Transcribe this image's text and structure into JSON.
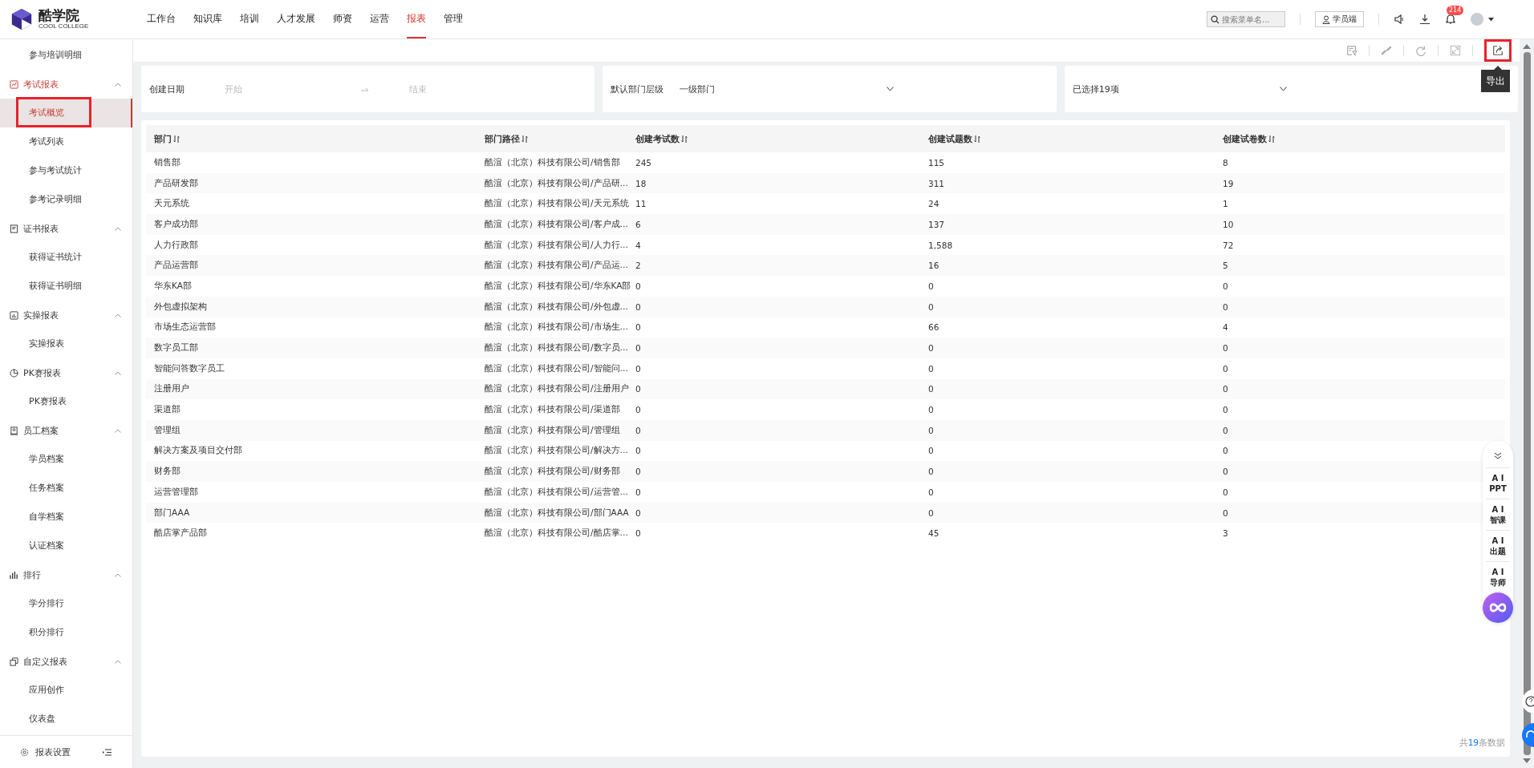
{
  "brand": {
    "name": "酷学院",
    "sub": "COOL COLLEGE"
  },
  "nav": [
    {
      "label": "工作台",
      "selected": false
    },
    {
      "label": "知识库",
      "selected": false
    },
    {
      "label": "培训",
      "selected": false
    },
    {
      "label": "人才发展",
      "selected": false
    },
    {
      "label": "师资",
      "selected": false
    },
    {
      "label": "运营",
      "selected": false
    },
    {
      "label": "报表",
      "selected": true
    },
    {
      "label": "管理",
      "selected": false
    }
  ],
  "header_right": {
    "search": {
      "placeholder": "搜索菜单名..."
    },
    "student_button": "学员端",
    "notification_count": "214"
  },
  "sidebar": {
    "leading_items": [
      {
        "label": "参与培训明细",
        "selected": false,
        "highlighted": false
      }
    ],
    "groups": [
      {
        "label": "考试报表",
        "active": true,
        "expanded": true,
        "children": [
          {
            "label": "考试概览",
            "selected": true,
            "highlighted": true
          },
          {
            "label": "考试列表",
            "selected": false,
            "highlighted": false
          },
          {
            "label": "参与考试统计",
            "selected": false,
            "highlighted": false
          },
          {
            "label": "参考记录明细",
            "selected": false,
            "highlighted": false
          }
        ]
      },
      {
        "label": "证书报表",
        "active": false,
        "expanded": true,
        "children": [
          {
            "label": "获得证书统计",
            "selected": false,
            "highlighted": false
          },
          {
            "label": "获得证书明细",
            "selected": false,
            "highlighted": false
          }
        ]
      },
      {
        "label": "实操报表",
        "active": false,
        "expanded": true,
        "children": [
          {
            "label": "实操报表",
            "selected": false,
            "highlighted": false
          }
        ]
      },
      {
        "label": "PK赛报表",
        "active": false,
        "expanded": true,
        "children": [
          {
            "label": "PK赛报表",
            "selected": false,
            "highlighted": false
          }
        ]
      },
      {
        "label": "员工档案",
        "active": false,
        "expanded": true,
        "children": [
          {
            "label": "学员档案",
            "selected": false,
            "highlighted": false
          },
          {
            "label": "任务档案",
            "selected": false,
            "highlighted": false
          },
          {
            "label": "自学档案",
            "selected": false,
            "highlighted": false
          },
          {
            "label": "认证档案",
            "selected": false,
            "highlighted": false
          }
        ]
      },
      {
        "label": "排行",
        "active": false,
        "expanded": true,
        "children": [
          {
            "label": "学分排行",
            "selected": false,
            "highlighted": false
          },
          {
            "label": "积分排行",
            "selected": false,
            "highlighted": false
          }
        ]
      },
      {
        "label": "自定义报表",
        "active": false,
        "expanded": true,
        "children": [
          {
            "label": "应用创作",
            "selected": false,
            "highlighted": false
          },
          {
            "label": "仪表盘",
            "selected": false,
            "highlighted": false
          }
        ]
      }
    ],
    "footer": "报表设置"
  },
  "toolbar": {
    "export_highlighted": true,
    "tooltip": "导出"
  },
  "filters": {
    "date": {
      "label": "创建日期",
      "start_placeholder": "开始",
      "end_placeholder": "结束"
    },
    "level": {
      "label": "默认部门层级",
      "value": "一级部门"
    },
    "selection": {
      "value": "已选择19项"
    }
  },
  "table": {
    "columns": [
      "部门",
      "部门路径",
      "创建考试数",
      "创建试题数",
      "创建试卷数"
    ],
    "rows": [
      [
        "销售部",
        "酷渲（北京）科技有限公司/销售部",
        "245",
        "115",
        "8"
      ],
      [
        "产品研发部",
        "酷渲（北京）科技有限公司/产品研…",
        "18",
        "311",
        "19"
      ],
      [
        "天元系统",
        "酷渲（北京）科技有限公司/天元系统",
        "11",
        "24",
        "1"
      ],
      [
        "客户成功部",
        "酷渲（北京）科技有限公司/客户成…",
        "6",
        "137",
        "10"
      ],
      [
        "人力行政部",
        "酷渲（北京）科技有限公司/人力行…",
        "4",
        "1,588",
        "72"
      ],
      [
        "产品运营部",
        "酷渲（北京）科技有限公司/产品运…",
        "2",
        "16",
        "5"
      ],
      [
        "华东KA部",
        "酷渲（北京）科技有限公司/华东KA部",
        "0",
        "0",
        "0"
      ],
      [
        "外包虚拟架构",
        "酷渲（北京）科技有限公司/外包虚…",
        "0",
        "0",
        "0"
      ],
      [
        "市场生态运营部",
        "酷渲（北京）科技有限公司/市场生…",
        "0",
        "66",
        "4"
      ],
      [
        "数字员工部",
        "酷渲（北京）科技有限公司/数字员…",
        "0",
        "0",
        "0"
      ],
      [
        "智能问答数字员工",
        "酷渲（北京）科技有限公司/智能问…",
        "0",
        "0",
        "0"
      ],
      [
        "注册用户",
        "酷渲（北京）科技有限公司/注册用户",
        "0",
        "0",
        "0"
      ],
      [
        "渠道部",
        "酷渲（北京）科技有限公司/渠道部",
        "0",
        "0",
        "0"
      ],
      [
        "管理组",
        "酷渲（北京）科技有限公司/管理组",
        "0",
        "0",
        "0"
      ],
      [
        "解决方案及项目交付部",
        "酷渲（北京）科技有限公司/解决方…",
        "0",
        "0",
        "0"
      ],
      [
        "财务部",
        "酷渲（北京）科技有限公司/财务部",
        "0",
        "0",
        "0"
      ],
      [
        "运营管理部",
        "酷渲（北京）科技有限公司/运营管…",
        "0",
        "0",
        "0"
      ],
      [
        "部门AAA",
        "酷渲（北京）科技有限公司/部门AAA",
        "0",
        "0",
        "0"
      ],
      [
        "酷店掌产品部",
        "酷渲（北京）科技有限公司/酷店掌…",
        "0",
        "45",
        "3"
      ]
    ],
    "total": {
      "prefix": "共",
      "count": "19",
      "suffix": "条数据"
    }
  },
  "ai_tools": [
    {
      "line1": "A I",
      "line2": "PPT"
    },
    {
      "line1": "A I",
      "line2": "智课"
    },
    {
      "line1": "A I",
      "line2": "出题"
    },
    {
      "line1": "A I",
      "line2": "导师"
    }
  ]
}
